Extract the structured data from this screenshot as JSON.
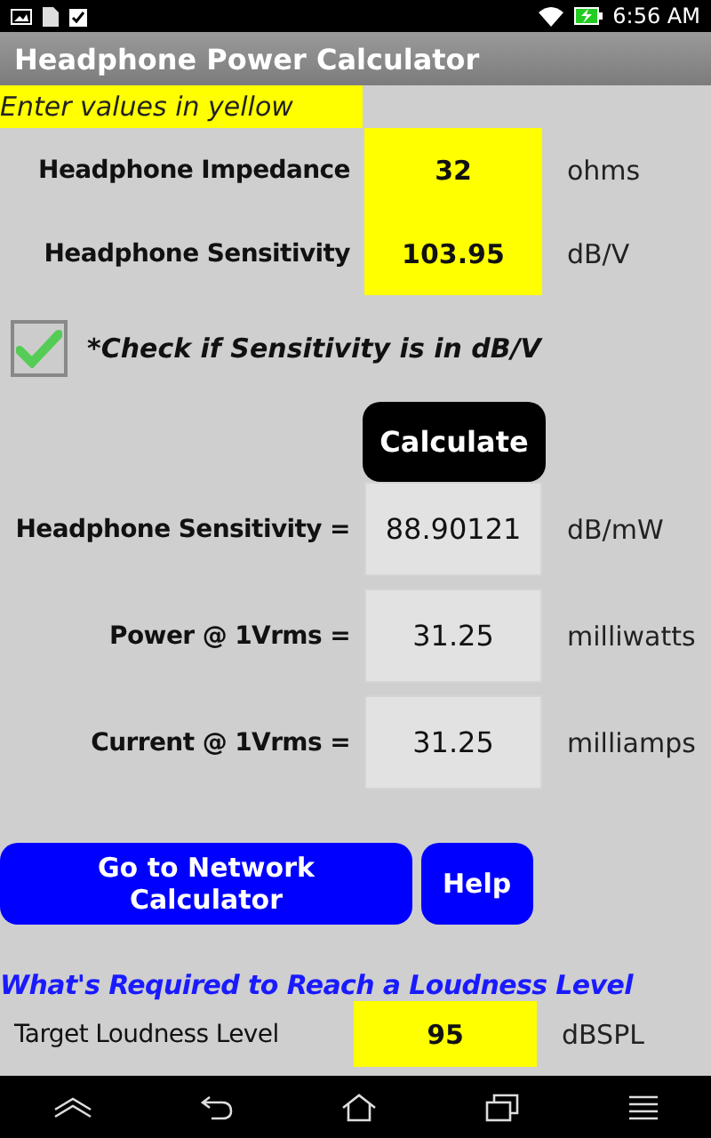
{
  "status_bar": {
    "time": "6:56 AM"
  },
  "window": {
    "title": "Headphone Power Calculator"
  },
  "hint": "Enter values in yellow",
  "inputs": [
    {
      "label": "Headphone Impedance",
      "value": "32",
      "unit": "ohms"
    },
    {
      "label": "Headphone Sensitivity",
      "value": "103.95",
      "unit": "dB/V"
    }
  ],
  "sensitivity_checkbox": {
    "label": "*Check if Sensitivity is in dB/V",
    "checked": true
  },
  "calculate_button": "Calculate",
  "results": [
    {
      "label": "Headphone Sensitivity =",
      "value": "88.90121",
      "unit": "dB/mW"
    },
    {
      "label": "Power @ 1Vrms =",
      "value": "31.25",
      "unit": "milliwatts"
    },
    {
      "label": "Current @ 1Vrms =",
      "value": "31.25",
      "unit": "milliamps"
    }
  ],
  "buttons": [
    "Go to Network Calculator",
    "Help"
  ],
  "loudness": {
    "heading": "What's Required to Reach a Loudness Level",
    "label": "Target Loudness Level",
    "value": "95",
    "unit": "dBSPL"
  }
}
